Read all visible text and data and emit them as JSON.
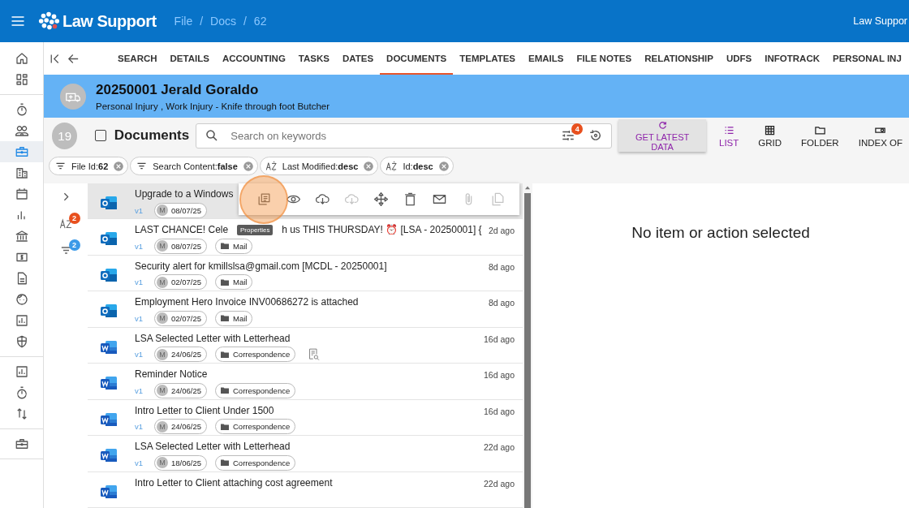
{
  "topbar": {
    "app_name": "Law Support",
    "breadcrumb": [
      "File",
      "Docs",
      "62"
    ],
    "separator": "/",
    "user": "Law Suppor"
  },
  "rail": [
    {
      "kind": "home",
      "selected": false
    },
    {
      "kind": "dashboard",
      "selected": false
    },
    {
      "kind": "divider"
    },
    {
      "kind": "timer",
      "selected": false
    },
    {
      "kind": "people",
      "selected": false
    },
    {
      "kind": "briefcase",
      "selected": true
    },
    {
      "kind": "building",
      "selected": false
    },
    {
      "kind": "calendar",
      "selected": false
    },
    {
      "kind": "bars",
      "selected": false
    },
    {
      "kind": "bank",
      "selected": false
    },
    {
      "kind": "dollar",
      "selected": false
    },
    {
      "kind": "doc",
      "selected": false
    },
    {
      "kind": "face",
      "selected": false
    },
    {
      "kind": "chart",
      "selected": false
    },
    {
      "kind": "shield",
      "selected": false
    },
    {
      "kind": "divider"
    },
    {
      "kind": "chartbox",
      "selected": false
    },
    {
      "kind": "timer",
      "selected": false
    },
    {
      "kind": "sort",
      "selected": false
    },
    {
      "kind": "divider"
    },
    {
      "kind": "briefcase",
      "selected": false
    },
    {
      "kind": "divider"
    }
  ],
  "tabs": [
    {
      "label": "SEARCH",
      "selected": false
    },
    {
      "label": "DETAILS",
      "selected": false
    },
    {
      "label": "ACCOUNTING",
      "selected": false
    },
    {
      "label": "TASKS",
      "selected": false
    },
    {
      "label": "DATES",
      "selected": false
    },
    {
      "label": "DOCUMENTS",
      "selected": true
    },
    {
      "label": "TEMPLATES",
      "selected": false
    },
    {
      "label": "EMAILS",
      "selected": false
    },
    {
      "label": "FILE NOTES",
      "selected": false
    },
    {
      "label": "RELATIONSHIP",
      "selected": false
    },
    {
      "label": "UDFS",
      "selected": false
    },
    {
      "label": "INFOTRACK",
      "selected": false
    },
    {
      "label": "PERSONAL INJ",
      "selected": false
    }
  ],
  "matter": {
    "title": "20250001 Jerald Goraldo",
    "subtitle": "Personal Injury , Work Injury - Knife through foot Butcher"
  },
  "toolbar": {
    "count": "19",
    "select_all_checked": false,
    "title": "Documents",
    "search": {
      "placeholder": "Search on keywords"
    },
    "filter_badge": "4",
    "refresh_button": "GET LATEST DATA",
    "views": [
      {
        "kind": "list",
        "label": "LIST",
        "selected": true
      },
      {
        "kind": "grid",
        "label": "GRID",
        "selected": false
      },
      {
        "kind": "folder",
        "label": "FOLDER",
        "selected": false
      },
      {
        "kind": "index",
        "label": "INDEX OF",
        "selected": false
      }
    ]
  },
  "chips": [
    {
      "kind": "filter",
      "text": "File Id:**62**"
    },
    {
      "kind": "filter",
      "text": "Search Content:**false**"
    },
    {
      "kind": "sort",
      "text": "Last Modified:**desc**"
    },
    {
      "kind": "sort",
      "text": "Id:**desc**"
    }
  ],
  "side": {
    "sort_badge": "2",
    "filter_badge": "2"
  },
  "documents": [
    {
      "kind": "mail",
      "title": "Upgrade to a Windows",
      "version": "v1",
      "author": "M",
      "date": "08/07/25",
      "selected": true,
      "preview": false
    },
    {
      "kind": "mail",
      "title": "LAST CHANCE! Cele",
      "title_rest": "h us THIS THURSDAY! ⏰ [LSA - 20250001] {",
      "version": "v1",
      "author": "M",
      "date": "08/07/25",
      "folder": "Mail",
      "age": "2d ago",
      "selected": false,
      "preview": false
    },
    {
      "kind": "mail",
      "title": "Security alert for kmillslsa@gmail.com [MCDL - 20250001]",
      "version": "v1",
      "author": "M",
      "date": "02/07/25",
      "folder": "Mail",
      "age": "8d ago",
      "selected": false,
      "preview": false
    },
    {
      "kind": "mail",
      "title": "Employment Hero Invoice INV00686272 is attached",
      "version": "v1",
      "author": "M",
      "date": "02/07/25",
      "folder": "Mail",
      "age": "8d ago",
      "selected": false,
      "preview": false
    },
    {
      "kind": "word",
      "title": "LSA Selected Letter with Letterhead",
      "version": "v1",
      "author": "M",
      "date": "24/06/25",
      "folder": "Correspondence",
      "age": "16d ago",
      "selected": false,
      "preview": true
    },
    {
      "kind": "word",
      "title": "Reminder Notice",
      "version": "v1",
      "author": "M",
      "date": "24/06/25",
      "folder": "Correspondence",
      "age": "16d ago",
      "selected": false,
      "preview": false
    },
    {
      "kind": "word",
      "title": "Intro Letter to Client Under 1500",
      "version": "v1",
      "author": "M",
      "date": "24/06/25",
      "folder": "Correspondence",
      "age": "16d ago",
      "selected": false,
      "preview": false
    },
    {
      "kind": "word",
      "title": "LSA Selected Letter with Letterhead",
      "version": "v1",
      "author": "M",
      "date": "18/06/25",
      "folder": "Correspondence",
      "age": "22d ago",
      "selected": false,
      "preview": false
    },
    {
      "kind": "word",
      "title": "Intro Letter to Client attaching cost agreement",
      "age": "22d ago",
      "selected": false,
      "preview": false
    }
  ],
  "action_bar": {
    "tooltip": "Properties",
    "actions": [
      {
        "kind": "properties",
        "disabled": false
      },
      {
        "kind": "view",
        "disabled": false
      },
      {
        "kind": "download",
        "disabled": false
      },
      {
        "kind": "download",
        "disabled": true
      },
      {
        "kind": "move",
        "disabled": false
      },
      {
        "kind": "delete",
        "disabled": false
      },
      {
        "kind": "email",
        "disabled": false
      },
      {
        "kind": "attach",
        "disabled": true
      },
      {
        "kind": "copy",
        "disabled": true
      }
    ]
  },
  "detail": {
    "message": "No item or action selected"
  }
}
